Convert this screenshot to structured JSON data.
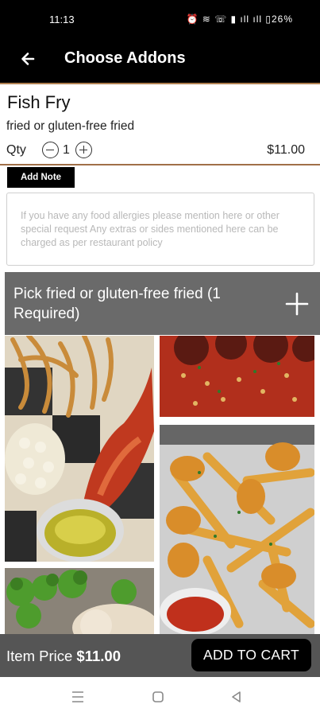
{
  "status_bar": {
    "time": "11:13",
    "indicators": "⏰ ≋ ☏ ▮ ıll ıll ▯26%",
    "battery": "26%"
  },
  "app_bar": {
    "back_icon": "arrow-left-icon",
    "title": "Choose Addons"
  },
  "item": {
    "name": "Fish Fry",
    "description": "fried or gluten-free fried",
    "qty_label": "Qty",
    "qty_value": "1",
    "price": "$11.00"
  },
  "note": {
    "button_label": "Add Note",
    "placeholder": "If you have any food allergies please mention here or other special request Any extras or sides mentioned here can be charged as per restaurant policy"
  },
  "option_group": {
    "title": "Pick fried or gluten-free fried (1 Required)",
    "expand_icon": "plus-icon"
  },
  "footer": {
    "price_label": "Item Price",
    "price_value": "$11.00",
    "cart_button": "ADD TO CART"
  },
  "nav": {
    "icons": [
      "menu-icon",
      "home-icon",
      "back-triangle-icon"
    ]
  }
}
